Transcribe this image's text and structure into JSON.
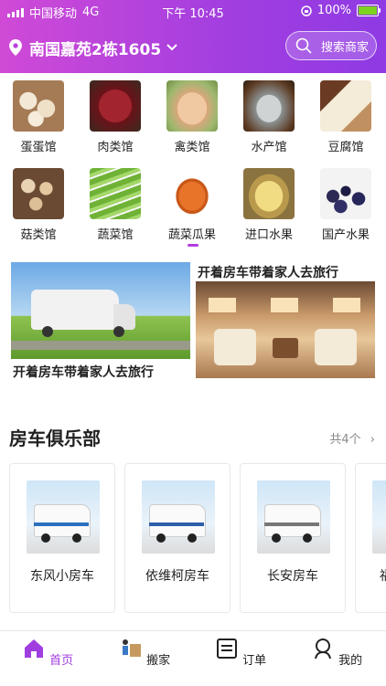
{
  "status_bar": {
    "carrier": "中国移动",
    "network": "4G",
    "time": "下午 10:45",
    "battery": "100%"
  },
  "header": {
    "location": "南国嘉苑2栋1605",
    "search_placeholder": "搜索商家"
  },
  "categories": [
    {
      "label": "蛋蛋馆",
      "icon": "eggs"
    },
    {
      "label": "肉类馆",
      "icon": "meat"
    },
    {
      "label": "禽类馆",
      "icon": "poultry"
    },
    {
      "label": "水产馆",
      "icon": "fish"
    },
    {
      "label": "豆腐馆",
      "icon": "tofu"
    },
    {
      "label": "菇类馆",
      "icon": "mushroom"
    },
    {
      "label": "蔬菜馆",
      "icon": "vegetable"
    },
    {
      "label": "蔬菜瓜果",
      "icon": "papaya"
    },
    {
      "label": "进口水果",
      "icon": "durian"
    },
    {
      "label": "国产水果",
      "icon": "grapes"
    }
  ],
  "banner": {
    "caption_left": "开着房车带着家人去旅行",
    "caption_right": "开着房车带着家人去旅行"
  },
  "club": {
    "title": "房车俱乐部",
    "count_label": "共4个",
    "items": [
      {
        "name": "东风小房车"
      },
      {
        "name": "依维柯房车"
      },
      {
        "name": "长安房车"
      },
      {
        "name": "福"
      }
    ]
  },
  "tabs": [
    {
      "label": "首页",
      "icon": "home-icon",
      "active": true
    },
    {
      "label": "搬家",
      "icon": "mover-icon",
      "active": false
    },
    {
      "label": "订单",
      "icon": "order-icon",
      "active": false
    },
    {
      "label": "我的",
      "icon": "profile-icon",
      "active": false
    }
  ],
  "colors": {
    "accent": "#a13ee0",
    "header_start": "#d04ad6",
    "header_end": "#8f3ae4"
  }
}
